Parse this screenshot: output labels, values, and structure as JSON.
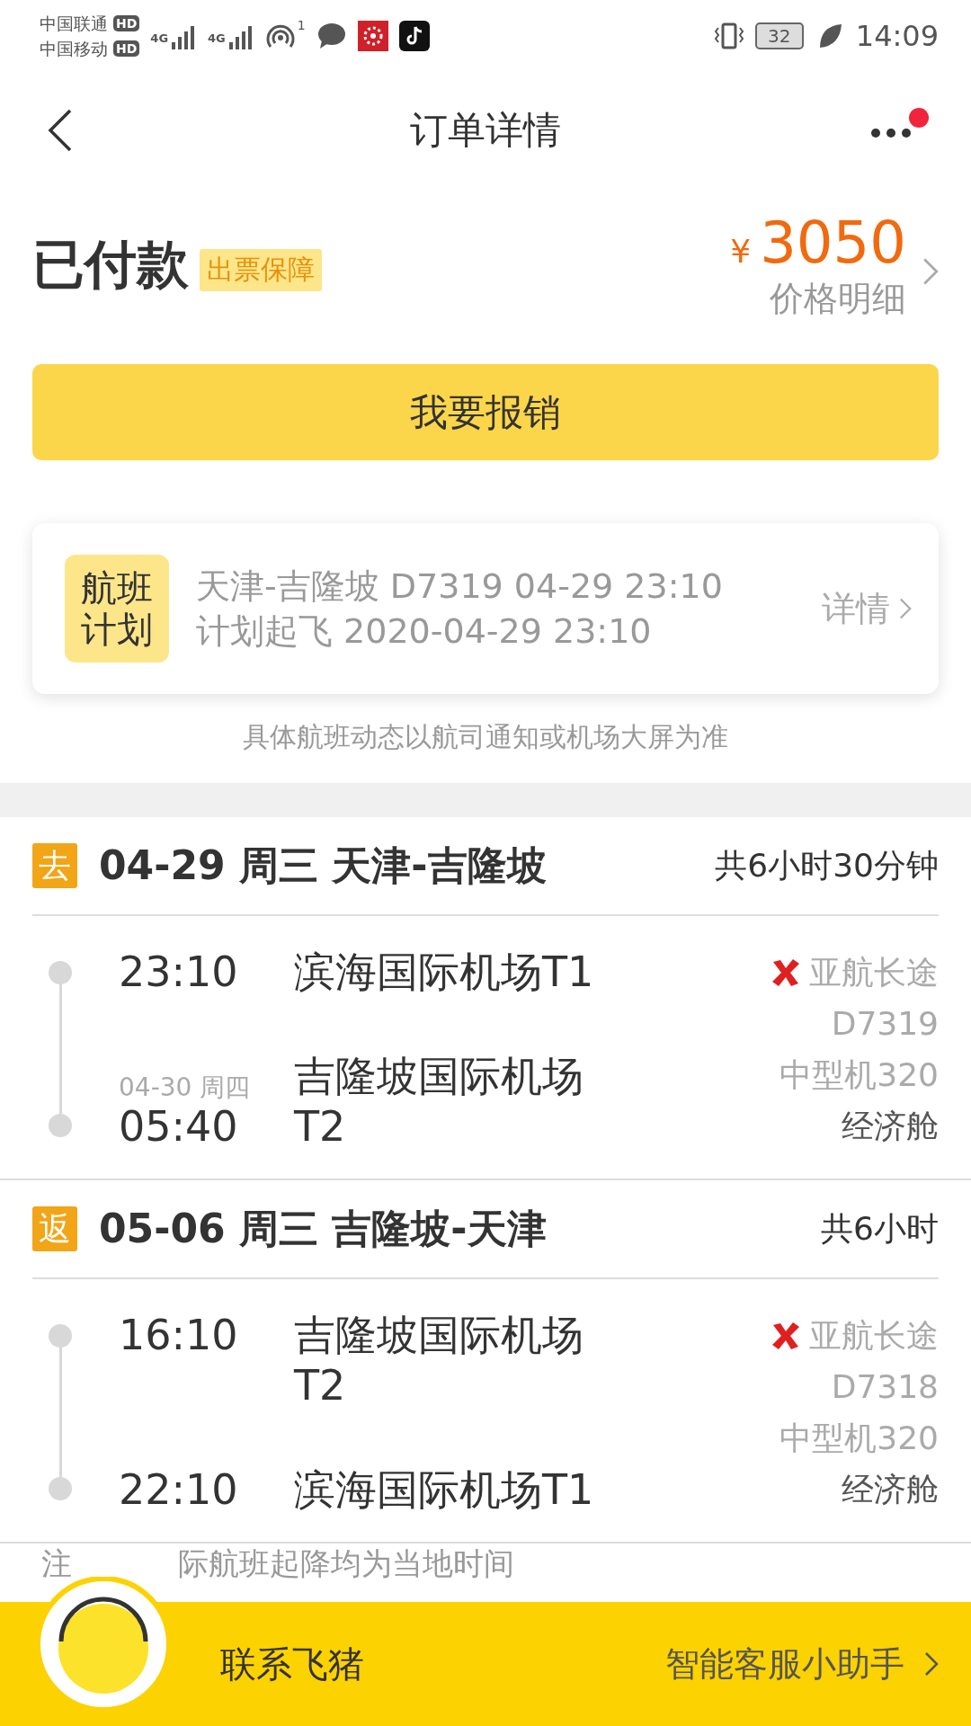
{
  "status_bar": {
    "carriers": [
      {
        "name": "中国联通",
        "badge": "HD"
      },
      {
        "name": "中国移动",
        "badge": "HD"
      }
    ],
    "network_labels": [
      "4G",
      "4G"
    ],
    "hotspot_count": "1",
    "battery": "32",
    "time": "14:09"
  },
  "header": {
    "title": "订单详情",
    "has_notification": true
  },
  "order": {
    "status": "已付款",
    "tag": "出票保障",
    "currency": "¥",
    "price": "3050",
    "price_link": "价格明细"
  },
  "action_button": "我要报销",
  "flight_plan": {
    "badge": "航班计划",
    "lines": [
      "天津-吉隆坡 D7319 04-29 23:10",
      "计划起飞 2020-04-29 23:10"
    ],
    "link": "详情"
  },
  "plan_note": "具体航班动态以航司通知或机场大屏为准",
  "legs": [
    {
      "direction": "去",
      "title": "04-29 周三 天津-吉隆坡",
      "duration": "共6小时30分钟",
      "segment": {
        "depart_time": "23:10",
        "depart_airport": "滨海国际机场T1",
        "arrive_date": "04-30 周四",
        "arrive_time": "05:40",
        "arrive_airport": "吉隆坡国际机场T2",
        "airline": "亚航长途",
        "flight_no": "D7319",
        "aircraft": "中型机320",
        "cabin": "经济舱"
      }
    },
    {
      "direction": "返",
      "title": "05-06 周三 吉隆坡-天津",
      "duration": "共6小时",
      "segment": {
        "depart_time": "16:10",
        "depart_airport": "吉隆坡国际机场T2",
        "arrive_time": "22:10",
        "arrive_airport": "滨海国际机场T1",
        "airline": "亚航长途",
        "flight_no": "D7318",
        "aircraft": "中型机320",
        "cabin": "经济舱"
      }
    }
  ],
  "footnote_parts": [
    "注",
    "际航班起降均为当地时间"
  ],
  "footer": {
    "contact": "联系飞猪",
    "assistant": "智能客服小助手"
  }
}
